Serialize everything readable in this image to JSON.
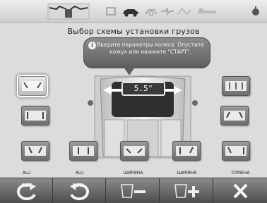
{
  "header": {
    "title": "Выбор схемы установки грузов",
    "status_icons": [
      "balancer-logo",
      "screen-icon",
      "car-icon",
      "tire-icon",
      "connection-icon",
      "sensor-icon",
      "scale-icon",
      "info-icon"
    ]
  },
  "balloon": {
    "info_symbol": "i",
    "message": "Введите параметры колеса. Опустите кожух или нажмите \"СТАРТ\"."
  },
  "wheel": {
    "width_value": "5.5\""
  },
  "bottom": {
    "labels": [
      "ALU",
      "ALU",
      "ШИРИНА",
      "ШИРИНА",
      "ОТМЕНА"
    ],
    "btn_alu_prev_caption": "ALU",
    "btn_alu_next_caption": "ALU"
  },
  "colors": {
    "bar_top": "#8c8c8c",
    "bar_bottom": "#4c4c4c",
    "selected": "#e6e6e6"
  }
}
